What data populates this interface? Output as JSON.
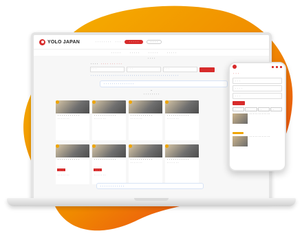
{
  "brand": {
    "name": "YOLO JAPAN",
    "accent": "#d72b2b",
    "blob_colors": [
      "#f6b400",
      "#f08a00",
      "#e8261e"
    ]
  },
  "header": {
    "links": [
      "・・・・・・・・",
      "・・・",
      "・・・"
    ],
    "primary_button": "・・・・・",
    "secondary_button": "・・・・"
  },
  "nav": {
    "items": [
      "・・・・・",
      "・・・・・",
      "・・・・・",
      "・・・・・"
    ]
  },
  "tag_line": "・・・・",
  "search": {
    "label": "・・・・",
    "link": "・・・・ ・・・ ・・・",
    "placeholder": "・・・"
  },
  "info_text": "・・・・・・・・・・・・・・・・・・・・・・・・・・・・・・・・・・・・・・・・・・・",
  "banner_top": "・・・・・・・・・・・・・・・",
  "section_title": "・・・・・・・・",
  "cards": [
    {
      "title": "・・・・・・・・・・・",
      "meta": "・・・・・・・"
    },
    {
      "title": "・・・・・・・・・・・",
      "meta": "・・・・・・・"
    },
    {
      "title": "・・・・・・・・・・・",
      "meta": "・・・・・・・"
    },
    {
      "title": "・・・・・・・・・・・",
      "meta": "・・・・・・・"
    },
    {
      "title": "・・・・・・・・・・・",
      "meta": "・・・・・・・",
      "tag": "・・・"
    },
    {
      "title": "・・・・・・・・・・・",
      "meta": "・・・・・・・",
      "tag": "・・・"
    },
    {
      "title": "・・・・・・・・・・・",
      "meta": "・・・・・・・"
    },
    {
      "title": "・・・・・・・・・・・",
      "meta": "・・・・・・・"
    }
  ],
  "banner_bottom": "・・・・・・・・・・・・",
  "phone": {
    "label": "・・・",
    "fields": [
      "・・・",
      "・・・・",
      "・・・"
    ],
    "tabs": [
      "・・",
      "・・",
      "・・",
      "・・"
    ],
    "cards": [
      {
        "text": "・・・・・・・・・・・・"
      },
      {
        "text": "・・・・・・・・・・・・"
      }
    ]
  }
}
